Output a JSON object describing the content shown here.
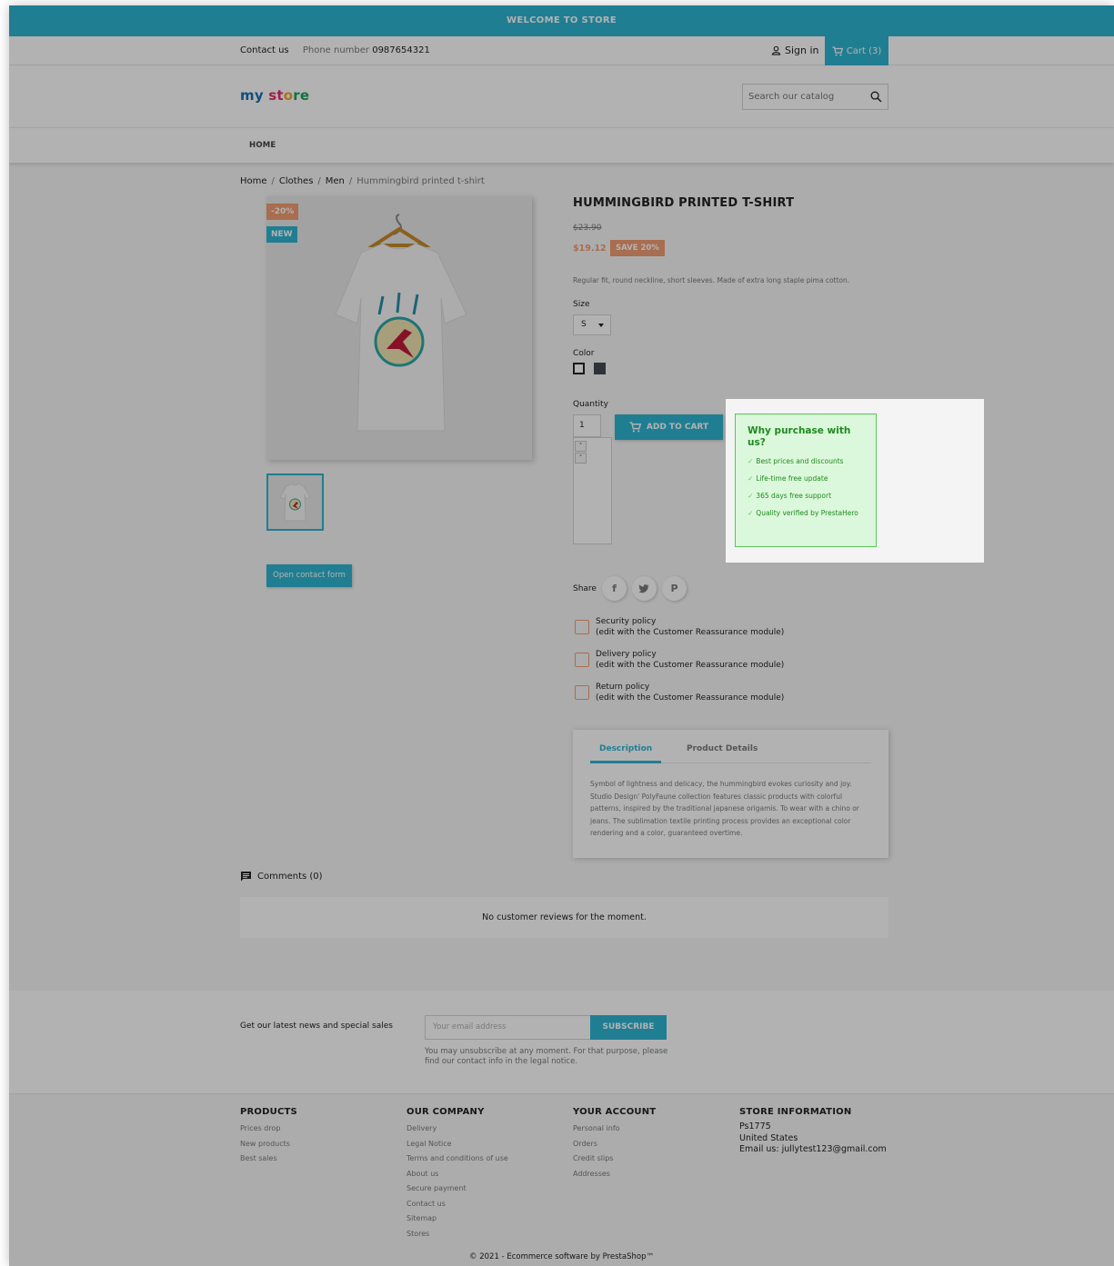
{
  "banner": {
    "text": "WELCOME TO STORE"
  },
  "topnav": {
    "contact": "Contact us",
    "phone_label": "Phone number",
    "phone": "0987654321",
    "signin": "Sign in",
    "cart": "Cart (3)"
  },
  "logo": {
    "part1": "my",
    "part2": " st",
    "part3": "o",
    "part4": "re"
  },
  "search": {
    "placeholder": "Search our catalog"
  },
  "menu": {
    "home": "HOME"
  },
  "breadcrumb": {
    "items": [
      "Home",
      "Clothes",
      "Men"
    ],
    "current": "Hummingbird printed t-shirt"
  },
  "product": {
    "title": "HUMMINGBIRD PRINTED T-SHIRT",
    "old_price": "$23.90",
    "price": "$19.12",
    "save": "SAVE 20%",
    "flag_discount": "-20%",
    "flag_new": "NEW",
    "short_desc": "Regular fit, round neckline, short sleeves. Made of extra long staple pima cotton.",
    "size_label": "Size",
    "size_value": "S",
    "color_label": "Color",
    "quantity_label": "Quantity",
    "quantity": "1",
    "add_to_cart": "ADD TO CART",
    "contact_form": "Open contact form"
  },
  "why": {
    "title": "Why purchase with us?",
    "items": [
      "Best prices and discounts",
      "Life-time free update",
      "365 days free support",
      "Quality verified by PrestaHero"
    ]
  },
  "share": {
    "label": "Share",
    "icons": [
      "facebook-icon",
      "twitter-icon",
      "pinterest-icon"
    ]
  },
  "reassurance": [
    {
      "title": "Security policy",
      "sub": "(edit with the Customer Reassurance module)"
    },
    {
      "title": "Delivery policy",
      "sub": "(edit with the Customer Reassurance module)"
    },
    {
      "title": "Return policy",
      "sub": "(edit with the Customer Reassurance module)"
    }
  ],
  "tabs": {
    "description": "Description",
    "details": "Product Details",
    "body": "Symbol of lightness and delicacy, the hummingbird evokes curiosity and joy. Studio Design' PolyFaune collection features classic products with colorful patterns, inspired by the traditional japanese origamis. To wear with a chino or jeans. The sublimation textile printing process provides an exceptional color rendering and a color, guaranteed overtime."
  },
  "comments": {
    "heading": "Comments (0)",
    "empty": "No customer reviews for the moment."
  },
  "newsletter": {
    "text": "Get our latest news and special sales",
    "placeholder": "Your email address",
    "button": "SUBSCRIBE",
    "note": "You may unsubscribe at any moment. For that purpose, please find our contact info in the legal notice."
  },
  "footer": {
    "products": {
      "title": "PRODUCTS",
      "links": [
        "Prices drop",
        "New products",
        "Best sales"
      ]
    },
    "company": {
      "title": "OUR COMPANY",
      "links": [
        "Delivery",
        "Legal Notice",
        "Terms and conditions of use",
        "About us",
        "Secure payment",
        "Contact us",
        "Sitemap",
        "Stores"
      ]
    },
    "account": {
      "title": "YOUR ACCOUNT",
      "links": [
        "Personal info",
        "Orders",
        "Credit slips",
        "Addresses"
      ]
    },
    "store": {
      "title": "STORE INFORMATION",
      "lines": [
        "Ps1775",
        "United States",
        "Email us: jullytest123@gmail.com"
      ]
    },
    "copyright": "© 2021 - Ecommerce software by PrestaShop™"
  },
  "colors": {
    "accent": "#2fb5d2",
    "discount": "#f39d72",
    "why_bg": "#dcf8dc",
    "why_border": "#56c756",
    "why_text": "#1e8a1e"
  }
}
